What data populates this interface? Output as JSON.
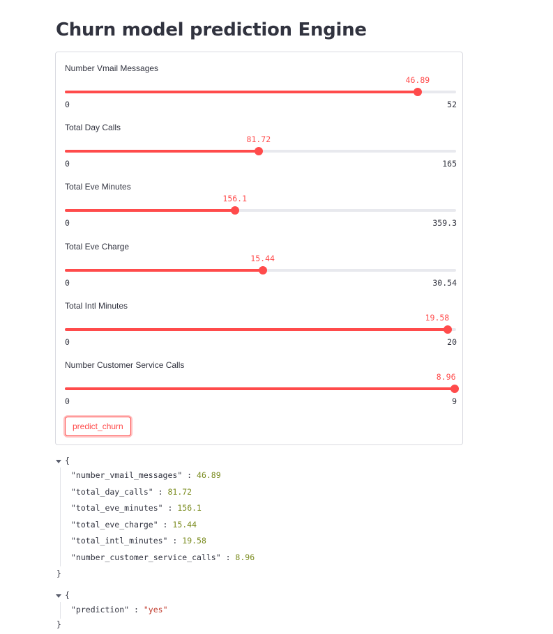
{
  "page": {
    "title": "Churn model prediction Engine"
  },
  "colors": {
    "accent": "#ff4b4b",
    "track": "#e8e9ee",
    "text": "#31333f",
    "json_number": "#7a8b1e",
    "json_string": "#c0392b"
  },
  "sliders": [
    {
      "label": "Number Vmail Messages",
      "value": 46.89,
      "value_text": "46.89",
      "min": 0,
      "max": 52,
      "min_text": "0",
      "max_text": "52"
    },
    {
      "label": "Total Day Calls",
      "value": 81.72,
      "value_text": "81.72",
      "min": 0,
      "max": 165,
      "min_text": "0",
      "max_text": "165"
    },
    {
      "label": "Total Eve Minutes",
      "value": 156.1,
      "value_text": "156.1",
      "min": 0,
      "max": 359.3,
      "min_text": "0",
      "max_text": "359.3"
    },
    {
      "label": "Total Eve Charge",
      "value": 15.44,
      "value_text": "15.44",
      "min": 0,
      "max": 30.54,
      "min_text": "0",
      "max_text": "30.54"
    },
    {
      "label": "Total Intl Minutes",
      "value": 19.58,
      "value_text": "19.58",
      "min": 0,
      "max": 20,
      "min_text": "0",
      "max_text": "20"
    },
    {
      "label": "Number Customer Service Calls",
      "value": 8.96,
      "value_text": "8.96",
      "min": 0,
      "max": 9,
      "min_text": "0",
      "max_text": "9"
    }
  ],
  "button": {
    "label": "predict_churn"
  },
  "json_inputs": {
    "open": "{",
    "close": "}",
    "rows": [
      {
        "key": "\"number_vmail_messages\"",
        "sep": " : ",
        "value": "46.89"
      },
      {
        "key": "\"total_day_calls\"",
        "sep": " : ",
        "value": "81.72"
      },
      {
        "key": "\"total_eve_minutes\"",
        "sep": " : ",
        "value": "156.1"
      },
      {
        "key": "\"total_eve_charge\"",
        "sep": " : ",
        "value": "15.44"
      },
      {
        "key": "\"total_intl_minutes\"",
        "sep": " : ",
        "value": "19.58"
      },
      {
        "key": "\"number_customer_service_calls\"",
        "sep": " : ",
        "value": "8.96"
      }
    ]
  },
  "json_prediction": {
    "open": "{",
    "close": "}",
    "rows": [
      {
        "key": "\"prediction\"",
        "sep": " : ",
        "value": "\"yes\""
      }
    ]
  }
}
